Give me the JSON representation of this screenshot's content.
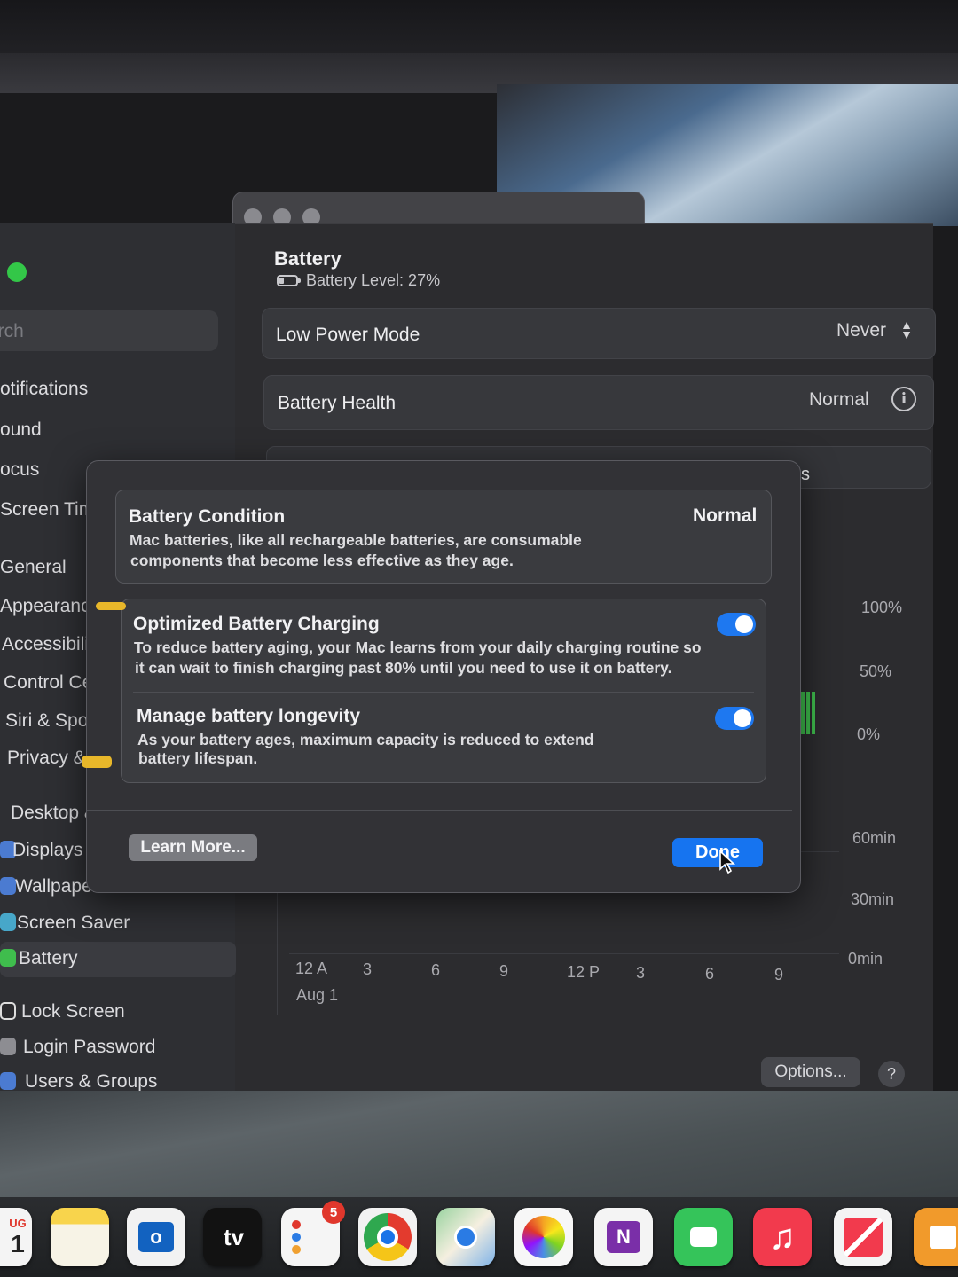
{
  "main": {
    "title": "Battery",
    "battery_level": "Battery Level: 27%",
    "low_power_mode": {
      "label": "Low Power Mode",
      "value": "Never"
    },
    "battery_health": {
      "label": "Battery Health",
      "value": "Normal"
    },
    "partial_row_suffix": "s",
    "chart": {
      "y_labels_top": [
        "100%",
        "50%",
        "0%"
      ],
      "y_labels_bottom": [
        "60min",
        "30min",
        "0min"
      ],
      "x_labels": [
        "12 A",
        "3",
        "6",
        "9",
        "12 P",
        "3",
        "6",
        "9"
      ],
      "date_label": "Aug 1"
    },
    "options_label": "Options...",
    "help_label": "?"
  },
  "sidebar": {
    "search_placeholder": "arch",
    "items": [
      "otifications",
      "ound",
      "ocus",
      "Screen Tim",
      "General",
      "Appearanc",
      "Accessibili",
      "Control Ce",
      "Siri & Spotl",
      "Privacy &",
      "Desktop &",
      "Displays",
      "Wallpaper",
      "Screen Saver",
      "Battery",
      "Lock Screen",
      "Login Password",
      "Users & Groups"
    ],
    "selected": "Battery"
  },
  "sheet": {
    "condition": {
      "title": "Battery Condition",
      "value": "Normal",
      "desc_line1": "Mac batteries, like all rechargeable batteries, are consumable",
      "desc_line2": "components that become less effective as they age."
    },
    "optimized": {
      "title": "Optimized Battery Charging",
      "desc_line1": "To reduce battery aging, your Mac learns from your daily charging routine so",
      "desc_line2": "it can wait to finish charging past 80% until you need to use it on battery.",
      "enabled": true
    },
    "longevity": {
      "title": "Manage battery longevity",
      "desc_line1": "As your battery ages, maximum capacity is reduced to extend",
      "desc_line2": "battery lifespan.",
      "enabled": true
    },
    "learn_more_label": "Learn More...",
    "done_label": "Done"
  },
  "dock": {
    "calendar_month": "UG",
    "calendar_day": "1",
    "tv_label": "tv",
    "reminders_badge": "5",
    "onenote_label": "N"
  },
  "colors": {
    "accent": "#1674f0",
    "toggle_on": "#1e78f0",
    "window_bg": "#2c2c2f",
    "sheet_bg": "#323236"
  }
}
